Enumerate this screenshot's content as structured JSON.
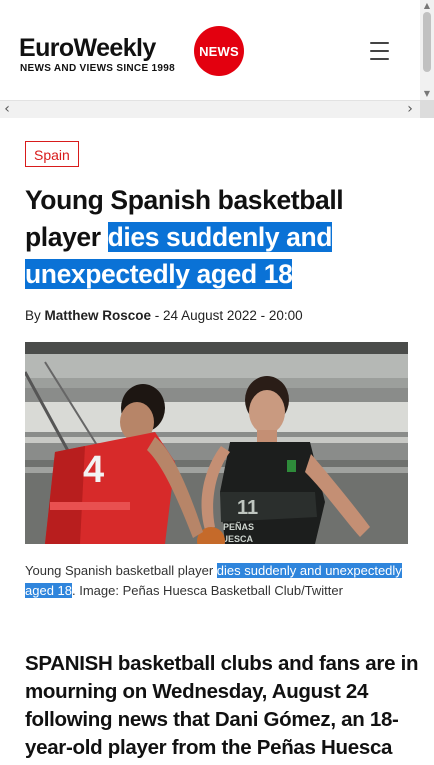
{
  "header": {
    "logo_text": "EuroWeekly",
    "logo_badge": "NEWS",
    "tagline": "NEWS AND VIEWS SINCE 1998",
    "menu_icon": "hamburger-icon"
  },
  "scrollbars": {
    "up_arrow": "▲",
    "down_arrow": "▼",
    "left_arrow": "‹",
    "right_arrow": "›"
  },
  "article": {
    "category": "Spain",
    "headline_plain": "Young Spanish basketball player ",
    "headline_highlight": "dies suddenly and unexpectedly aged 18",
    "byline": {
      "prefix": "By ",
      "author": "Matthew Roscoe",
      "date": " - 24 August 2022 - 20:00"
    },
    "image_jerseys": {
      "left_number": "4",
      "right_number": "11",
      "right_text_1": "PEÑAS",
      "right_text_2": "HUESCA"
    },
    "caption": {
      "before": "Young Spanish basketball player ",
      "highlight": "dies suddenly and unexpectedly aged 18",
      "after": ". Image: Peñas Huesca Basketball Club/Twitter"
    },
    "lead": "SPANISH basketball clubs and fans are in mourning on Wednesday, August 24 following news that Dani Gómez, an 18-year-old player from the Peñas Huesca"
  },
  "colors": {
    "brand_red": "#e3000f",
    "highlight_blue": "#0a72d6",
    "tag_red": "#d81b1b"
  }
}
